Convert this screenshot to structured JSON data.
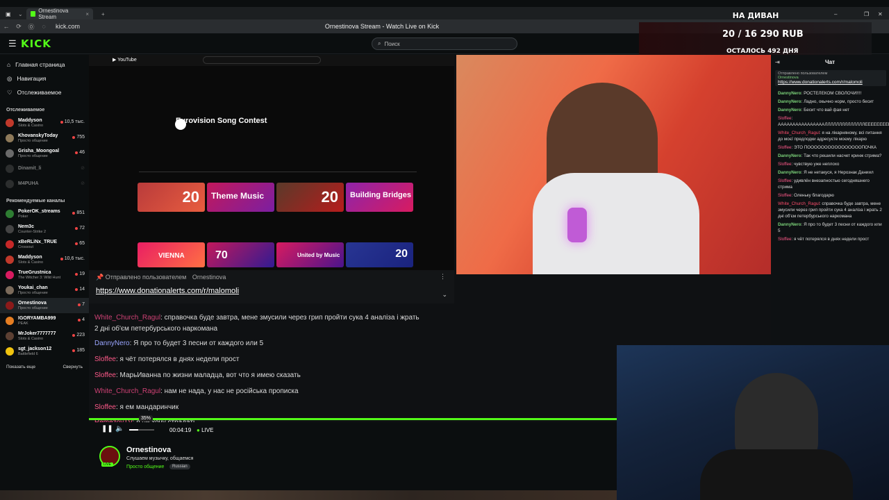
{
  "browser": {
    "tab_title": "Ornestinova Stream",
    "page_title": "Ornestinova Stream - Watch Live on Kick",
    "url": "kick.com"
  },
  "header": {
    "logo": "KICK",
    "search_placeholder": "Поиск"
  },
  "overlay": {
    "title": "НА ДИВАН",
    "amount": "20 / 16 290 RUB",
    "days": "ОСТАЛОСЬ 492 ДНЯ"
  },
  "sidebar": {
    "nav": [
      "Главная страница",
      "Навигация",
      "Отслеживаемое"
    ],
    "followed_title": "Отслеживаемое",
    "followed": [
      {
        "name": "Maddyson",
        "category": "Slots & Casino",
        "count": "10,5 тыс.",
        "color": "#c0392b"
      },
      {
        "name": "KhovanskyToday",
        "category": "Просто общение",
        "count": "755",
        "color": "#8e7a5a"
      },
      {
        "name": "Grisha_Moongoal",
        "category": "Просто общение",
        "count": "46",
        "color": "#6a6a6a"
      },
      {
        "name": "Dinamit_li",
        "category": "",
        "count": "",
        "color": "#555"
      },
      {
        "name": "M4PUHA",
        "category": "",
        "count": "",
        "color": "#555"
      }
    ],
    "recommended_title": "Рекомендуемые каналы",
    "recommended": [
      {
        "name": "PokerOK_streams",
        "category": "Poker",
        "count": "851",
        "color": "#2e7d32"
      },
      {
        "name": "Nem3c",
        "category": "Counter-Strike 2",
        "count": "72",
        "color": "#444"
      },
      {
        "name": "xBeRLiNx_TRUE",
        "category": "Crossout",
        "count": "65",
        "color": "#c62828"
      },
      {
        "name": "Maddyson",
        "category": "Slots & Casino",
        "count": "10,6 тыс.",
        "color": "#c0392b"
      },
      {
        "name": "TrueGrustnica",
        "category": "The Witcher 3: Wild Hunt",
        "count": "19",
        "color": "#d81b60"
      },
      {
        "name": "Youkai_chan",
        "category": "Просто общение",
        "count": "14",
        "color": "#7b6b5b"
      },
      {
        "name": "Ornestinova",
        "category": "Просто общение",
        "count": "7",
        "color": "#8b1a1a"
      },
      {
        "name": "IGORYAMBA999",
        "category": "PEAK",
        "count": "4",
        "color": "#e67e22"
      },
      {
        "name": "MrJoker7777777",
        "category": "Slots & Casino",
        "count": "223",
        "color": "#5c4033"
      },
      {
        "name": "sgt_jackson12",
        "category": "Battlefield 6",
        "count": "185",
        "color": "#f1c40f"
      }
    ],
    "show_more": "Показать еще",
    "collapse": "Свернуть"
  },
  "youtube": {
    "channel_title": "Eurovision Song Contest",
    "video_thumbs": [
      "20",
      "Theme Music",
      "20",
      "Building Bridges"
    ],
    "video_thumbs_row2": [
      "VIENNA",
      "70",
      "United by Music",
      "20"
    ]
  },
  "donation": {
    "label": "Отправлено пользователем",
    "user": "Ornestinova",
    "link": "https://www.donationalerts.com/r/malomoli"
  },
  "chat_overlay": [
    {
      "user": "White_Church_Ragul",
      "text": ": справочка буде завтра, мене змусили через грип пройти сука 4 аналіза і жрать"
    },
    {
      "user": "",
      "text": "2 дні об'єм петербурського наркомана"
    },
    {
      "user": "DannyNero",
      "text": ": Я про то будет 3 песни от каждого или 5"
    },
    {
      "user": "Sloffee",
      "text": ": я чёт потерялся в днях недели прост"
    },
    {
      "user": "Sloffee",
      "text": ": МарьИванна по жизни маладца, вот что я имею сказать"
    },
    {
      "user": "White_Church_Ragul",
      "text": ": нам не нада, у нас не російська прописка"
    },
    {
      "user": "Sloffee",
      "text": ": я ем мандаринчик"
    },
    {
      "user": "RemezovTV",
      "text": ": я не хочу страдать"
    }
  ],
  "player": {
    "time": "00:04:19",
    "live": "LIVE",
    "volume_tooltip": "35%",
    "volume_percent": 35
  },
  "stream_info": {
    "name": "Ornestinova",
    "title": "Слушаем музычку, общаемся",
    "category": "Просто общение",
    "language": "Russian",
    "live_badge": "LIVE"
  },
  "right_chat": {
    "title": "Чат",
    "pinned_label": "Отправлено пользователем",
    "pinned_user": "Ornestinova",
    "pinned_link": "https://www.donationalerts.com/r/malomoli",
    "messages": [
      {
        "user": "DannyNero",
        "text": ": РОСТЕЛЕКОМ СВОЛОЧИ!!!!"
      },
      {
        "user": "DannyNero",
        "text": ": Ладно, окычно норм, просто бесит"
      },
      {
        "user": "DannyNero",
        "text": ": Бесит что вай фая нет"
      },
      {
        "user": "Sloffee",
        "text": ": ААААААААААААААААЛЛЛЛЛЛЛЛЛЛЛЛЛЛЕЕЕЕЕЕЕЕЕЕЕЕЕЕЕЕОООООООООООООО"
      },
      {
        "user": "White_Church_Ragul",
        "text": ": я на лікарняному, всі питання до моєї предлодки адресуєте моєму лікарю"
      },
      {
        "user": "Sloffee",
        "text": ": ЭТО ПООООООООООООООООПОЧКА"
      },
      {
        "user": "DannyNero",
        "text": ": Так что решили насчет кринж стрима?"
      },
      {
        "user": "Sloffee",
        "text": ": чувствую уже неплохо"
      },
      {
        "user": "DannyNero",
        "text": ": Я не нетакуся, я Нерознак Даниил"
      },
      {
        "user": "Sloffee",
        "text": ": удивлён внезапностью сегодняшнего стрима"
      },
      {
        "user": "Sloffee",
        "text": ": Оленьку благодарю"
      },
      {
        "user": "White_Church_Ragul",
        "text": ": справочка буде завтра, мене змусили через грип пройти сука 4 аналіза і жрать 2 дні об'єм петербурського наркомана"
      },
      {
        "user": "DannyNero",
        "text": ": Я про то будет 3 песни от каждого или 5"
      },
      {
        "user": "Sloffee",
        "text": ": я чёт потерялся в днях недели прост"
      }
    ]
  },
  "colors": {
    "brand": "#53fc18",
    "bg": "#0b0e0f",
    "live": "#ef4444"
  }
}
